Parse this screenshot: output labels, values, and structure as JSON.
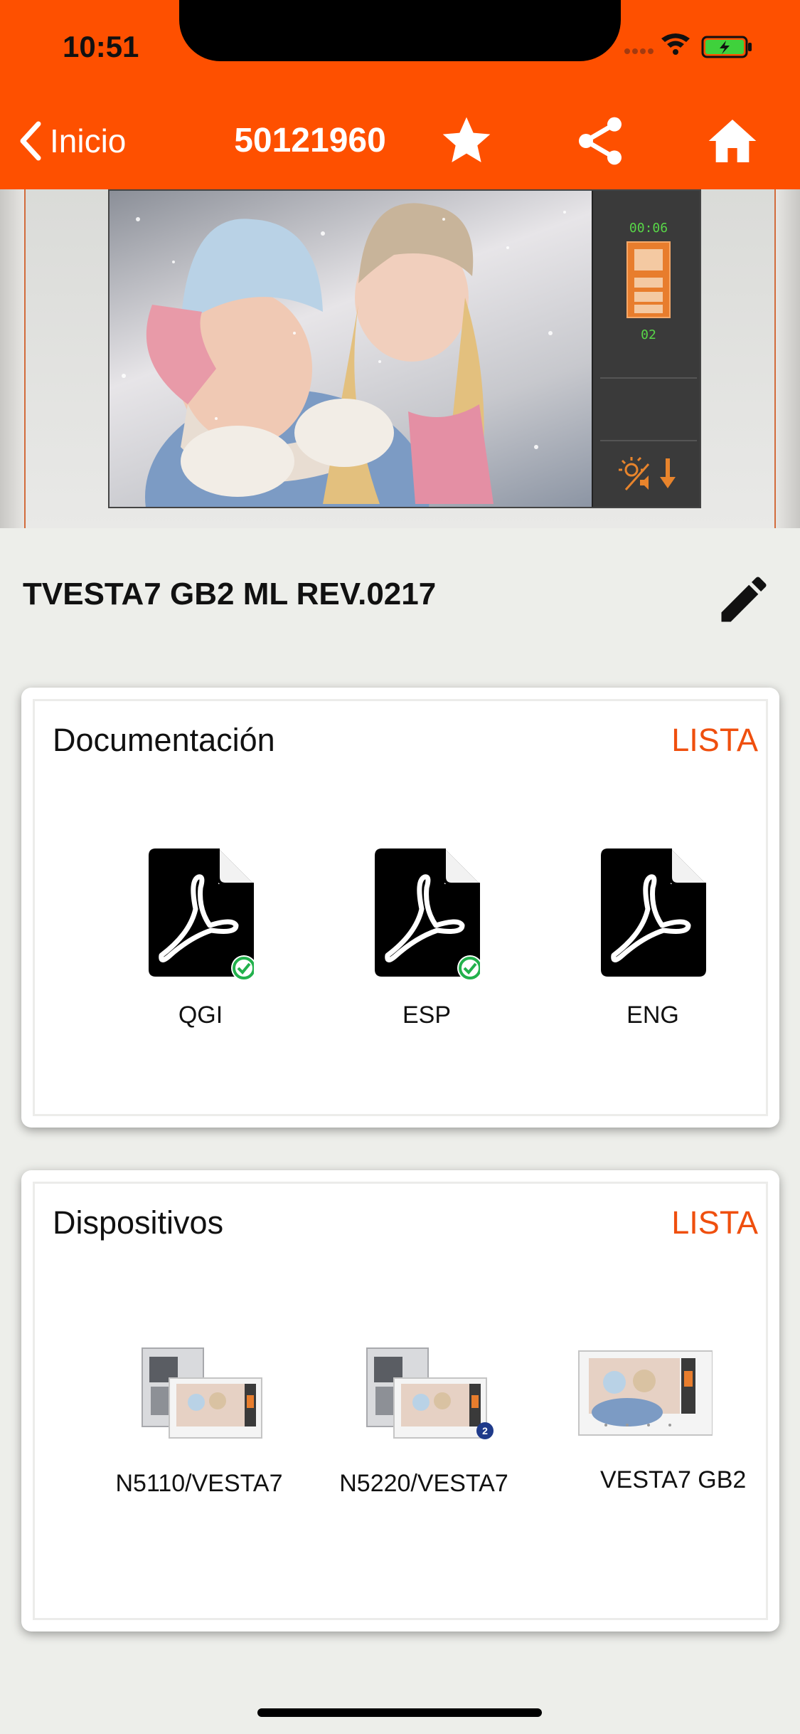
{
  "status_bar": {
    "time": "10:51"
  },
  "nav": {
    "back_label": "Inicio",
    "title": "50121960",
    "icons": [
      "chevron-left-icon",
      "star-icon",
      "share-icon",
      "home-icon"
    ]
  },
  "hero": {
    "panel_timer": "00:06",
    "panel_number": "02"
  },
  "device": {
    "name": "TVESTA7 GB2 ML REV.0217"
  },
  "documentation": {
    "title": "Documentación",
    "link": "LISTA",
    "items": [
      {
        "label": "QGI",
        "icon": "pdf-icon",
        "downloaded": true
      },
      {
        "label": "ESP",
        "icon": "pdf-icon",
        "downloaded": true
      },
      {
        "label": "ENG",
        "icon": "pdf-icon",
        "downloaded": false
      }
    ]
  },
  "devices": {
    "title": "Dispositivos",
    "link": "LISTA",
    "items": [
      {
        "label": "N5110/VESTA7",
        "badge": ""
      },
      {
        "label": "N5220/VESTA7",
        "badge": "2"
      },
      {
        "label": "VESTA7 GB2",
        "badge": ""
      }
    ]
  },
  "colors": {
    "brand": "#fe5000",
    "link": "#ef4f0e",
    "download_ok": "#22b14c",
    "badge": "#1f3a8a"
  }
}
